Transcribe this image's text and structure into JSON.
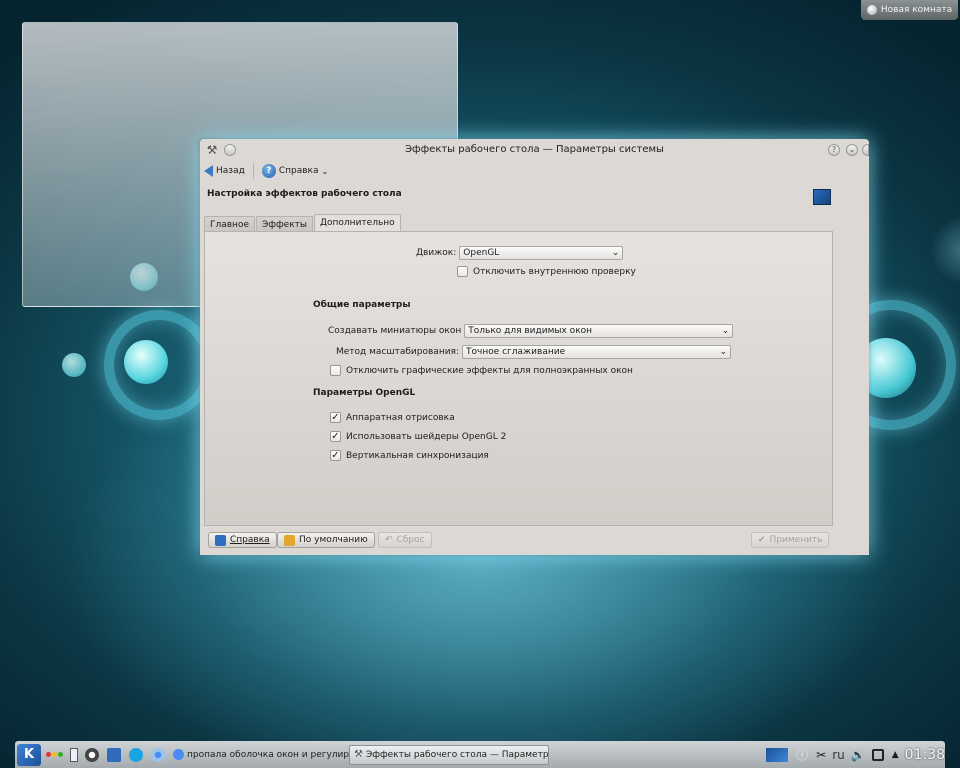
{
  "desktop": {
    "activity_label": "Новая комната"
  },
  "window": {
    "title": "Эффекты рабочего стола — Параметры системы",
    "toolbar": {
      "back_label": "Назад",
      "help_label": "Справка"
    },
    "header_title": "Настройка эффектов рабочего стола",
    "tabs": [
      "Главное",
      "Эффекты",
      "Дополнительно"
    ],
    "active_tab": "Дополнительно",
    "engine": {
      "label": "Движок:",
      "value": "OpenGL",
      "disable_check_label": "Отключить внутреннюю проверку",
      "disable_check_checked": false
    },
    "general": {
      "heading": "Общие параметры",
      "thumbnails_label": "Создавать миниатюры окон",
      "thumbnails_value": "Только для видимых окон",
      "scaling_label": "Метод масштабирования:",
      "scaling_value": "Точное сглаживание",
      "fullscreen_label": "Отключить графические эффекты для полноэкранных окон",
      "fullscreen_checked": false
    },
    "opengl": {
      "heading": "Параметры OpenGL",
      "hw_render_label": "Аппаратная отрисовка",
      "hw_render_checked": true,
      "shaders_label": "Использовать шейдеры OpenGL 2",
      "shaders_checked": true,
      "vsync_label": "Вертикальная синхронизация",
      "vsync_checked": true
    },
    "buttons": {
      "help": "Справка",
      "defaults": "По умолчанию",
      "reset": "Сброс",
      "apply": "Применить"
    }
  },
  "taskbar": {
    "tasks": [
      "пропала оболочка окон и регулировка",
      "Эффекты рабочего стола — Параметры"
    ],
    "keyboard_layout": "ru",
    "clock": "01:38"
  }
}
